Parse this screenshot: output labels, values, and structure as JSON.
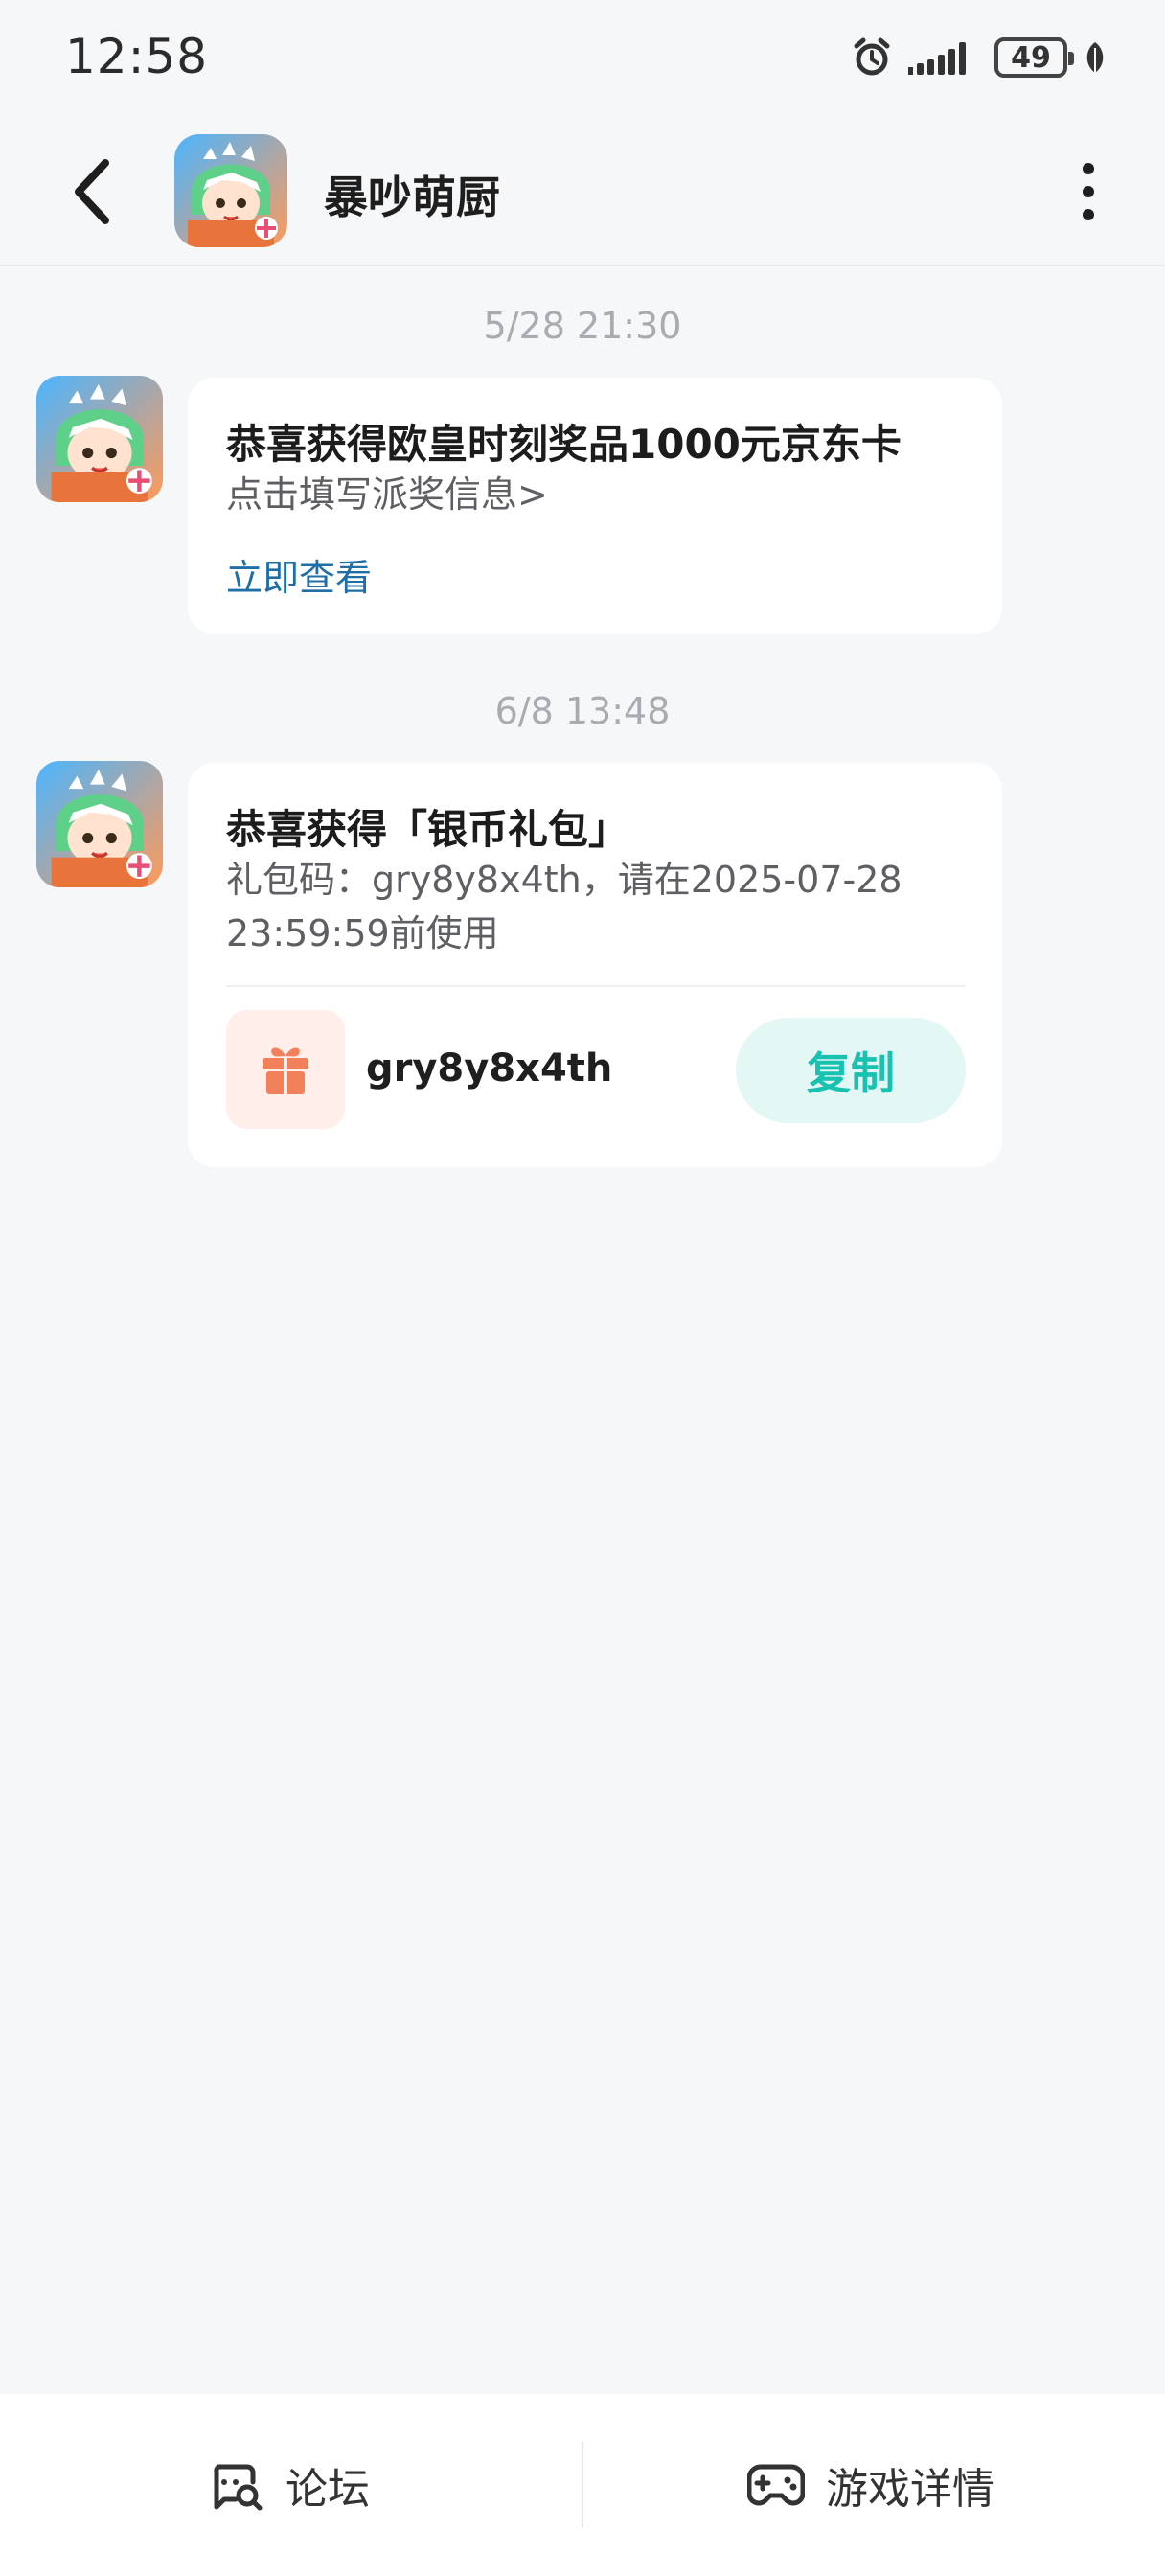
{
  "status_bar": {
    "time": "12:58",
    "battery": "49",
    "icons": [
      "alarm-icon",
      "signal-icon",
      "battery-icon",
      "leaf-icon"
    ]
  },
  "header": {
    "title": "暴吵萌厨",
    "back_icon": "chevron-left-icon",
    "more_icon": "more-vertical-icon"
  },
  "messages": [
    {
      "timestamp": "5/28  21:30",
      "title": "恭喜获得欧皇时刻奖品1000元京东卡",
      "subtitle": "点击填写派奖信息>",
      "link": "立即查看"
    },
    {
      "timestamp": "6/8  13:48",
      "title": "恭喜获得「银币礼包」",
      "subtitle_line1": "礼包码：gry8y8x4th，请在2025-07-28",
      "subtitle_line2": "23:59:59前使用",
      "gift_code": "gry8y8x4th",
      "copy_label": "复制"
    }
  ],
  "bottom_bar": {
    "forum_label": "论坛",
    "game_label": "游戏详情"
  },
  "colors": {
    "background": "#f6f7f9",
    "link": "#1f6fa6",
    "copy_accent": "#19c2b0",
    "gift_accent": "#f2805a"
  }
}
